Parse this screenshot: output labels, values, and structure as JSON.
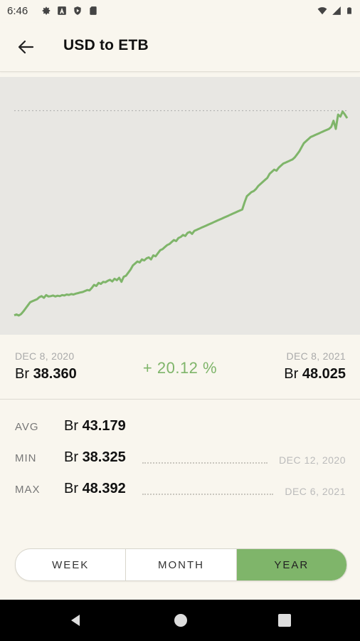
{
  "status_bar": {
    "time": "6:46",
    "left_icons": [
      "settings-icon",
      "font-icon",
      "shield-icon",
      "sd-card-icon"
    ],
    "right_icons": [
      "wifi-icon",
      "signal-icon",
      "battery-icon"
    ]
  },
  "app_bar": {
    "title": "USD to ETB",
    "back_icon": "arrow-left-icon"
  },
  "chart_data": {
    "type": "line",
    "x_start": "DEC 8, 2020",
    "x_end": "DEC 8, 2021",
    "series": [
      {
        "values": [
          38.36,
          38.4,
          38.35,
          38.42,
          38.55,
          38.7,
          38.85,
          39.0,
          39.05,
          39.1,
          39.15,
          39.25,
          39.3,
          39.22,
          39.35,
          39.28,
          39.3,
          39.33,
          39.28,
          39.32,
          39.3,
          39.35,
          39.33,
          39.38,
          39.36,
          39.4,
          39.38,
          39.42,
          39.45,
          39.48,
          39.5,
          39.55,
          39.6,
          39.58,
          39.7,
          39.85,
          39.8,
          39.95,
          39.9,
          40.0,
          39.98,
          40.05,
          40.1,
          40.02,
          40.15,
          40.08,
          40.2,
          40.0,
          40.25,
          40.3,
          40.45,
          40.6,
          40.8,
          40.9,
          41.0,
          40.95,
          41.1,
          41.05,
          41.15,
          41.2,
          41.1,
          41.3,
          41.25,
          41.4,
          41.55,
          41.6,
          41.7,
          41.8,
          41.85,
          41.95,
          42.05,
          42.0,
          42.15,
          42.2,
          42.3,
          42.25,
          42.4,
          42.45,
          42.35,
          42.5,
          42.55,
          42.6,
          42.65,
          42.7,
          42.75,
          42.8,
          42.85,
          42.9,
          42.95,
          43.0,
          43.05,
          43.1,
          43.15,
          43.2,
          43.25,
          43.3,
          43.35,
          43.4,
          43.45,
          43.5,
          43.55,
          43.9,
          44.2,
          44.3,
          44.4,
          44.45,
          44.55,
          44.7,
          44.8,
          44.9,
          45.0,
          45.1,
          45.3,
          45.4,
          45.5,
          45.45,
          45.6,
          45.7,
          45.8,
          45.85,
          45.9,
          45.95,
          46.0,
          46.1,
          46.25,
          46.4,
          46.6,
          46.8,
          46.9,
          47.0,
          47.1,
          47.15,
          47.2,
          47.25,
          47.3,
          47.35,
          47.4,
          47.45,
          47.5,
          47.6,
          47.9,
          47.5,
          48.2,
          48.1,
          48.35,
          48.2,
          48.025
        ]
      }
    ],
    "max_reference_value": 48.392,
    "ylim": [
      38.0,
      49.0
    ],
    "grid": false,
    "line_color": "#7fb56a",
    "reference_line_color": "#aaaaaa"
  },
  "range": {
    "start_date": "DEC 8, 2020",
    "start_currency": "Br",
    "start_value": "38.360",
    "change_percent": "+ 20.12 %",
    "end_date": "DEC 8, 2021",
    "end_currency": "Br",
    "end_value": "48.025"
  },
  "stats": {
    "avg": {
      "label": "AVG",
      "currency": "Br",
      "value": "43.179"
    },
    "min": {
      "label": "MIN",
      "currency": "Br",
      "value": "38.325",
      "date": "DEC 12, 2020"
    },
    "max": {
      "label": "MAX",
      "currency": "Br",
      "value": "48.392",
      "date": "DEC 6, 2021"
    }
  },
  "period_selector": {
    "options": [
      "WEEK",
      "MONTH",
      "YEAR"
    ],
    "selected": "YEAR"
  },
  "colors": {
    "accent": "#7fb56a",
    "background": "#f9f6ee",
    "chart_background": "#e8e7e3"
  }
}
